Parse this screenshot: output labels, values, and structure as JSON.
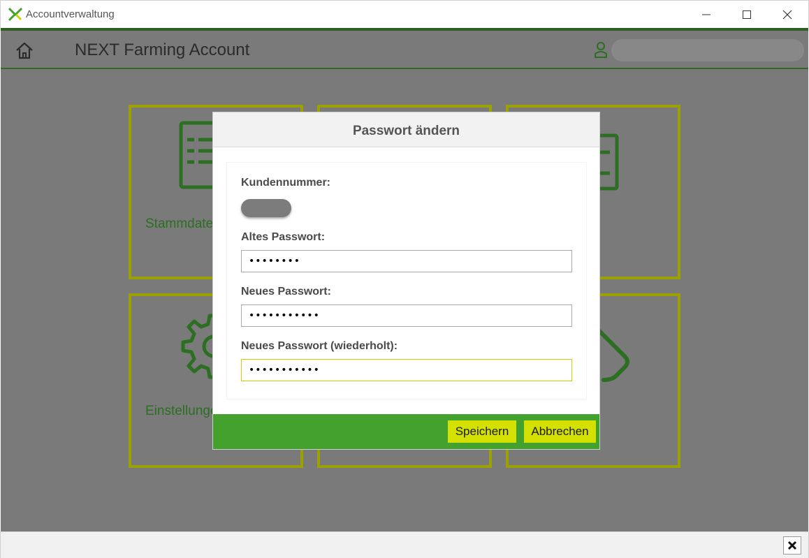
{
  "window": {
    "title": "Accountverwaltung"
  },
  "header": {
    "title": "NEXT Farming Account",
    "user_value": ""
  },
  "tiles": [
    {
      "label": "Stammdaten"
    },
    {
      "label": ""
    },
    {
      "label": ""
    },
    {
      "label": "Einstellungen"
    },
    {
      "label": ""
    },
    {
      "label": ""
    }
  ],
  "dialog": {
    "title": "Passwort ändern",
    "customer_label": "Kundennummer:",
    "customer_value": "",
    "old_password_label": "Altes Passwort:",
    "old_password_value": "••••••••",
    "new_password_label": "Neues Passwort:",
    "new_password_value": "•••••••••••",
    "repeat_password_label": "Neues Passwort (wiederholt):",
    "repeat_password_value": "•••••••••••",
    "save_label": "Speichern",
    "cancel_label": "Abbrechen"
  },
  "colors": {
    "accent_green": "#43a22e",
    "button_yellow": "#d4e000",
    "tile_border": "#9aa100",
    "tile_text": "#2c6e22"
  },
  "icons": {
    "app_logo": "next-farming-logo-icon",
    "home": "home-icon",
    "user": "user-icon",
    "close": "close-icon"
  }
}
